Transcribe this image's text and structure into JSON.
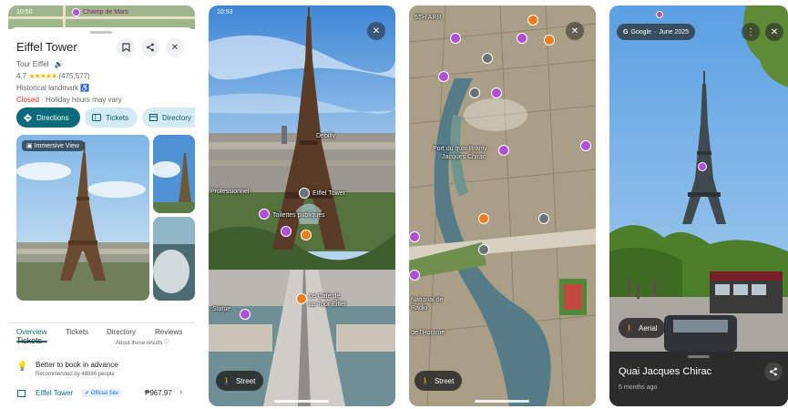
{
  "panel1": {
    "status_time": "10:50",
    "map_label": "Champ de Mars",
    "title": "Eiffel Tower",
    "subtitle": "Tour Eiffel",
    "rating": "4.7",
    "stars": "★★★★★",
    "review_count": "(475,577)",
    "category": "Historical landmark",
    "status_closed": "Closed",
    "status_hours": " · Holiday hours may vary",
    "buttons": {
      "directions": "Directions",
      "tickets": "Tickets",
      "directory": "Directory"
    },
    "photo_chip": "Immersive View",
    "tabs": [
      "Overview",
      "Tickets",
      "Directory",
      "Reviews"
    ],
    "tickets_heading": "Tickets",
    "about_results": "About these results",
    "tip_title": "Better to book in advance",
    "tip_sub": "Recommended by 48886 people",
    "ticket_vendor": "Eiffel Tower",
    "official_badge": "Official Site",
    "ticket_price": "₱967.97"
  },
  "panel2": {
    "status_time": "10:53",
    "labels": {
      "eiffel": "Eiffel Tower",
      "toilets": "Toilettes publiques",
      "pro": "Professionnel",
      "debilly": "Debilly",
      "cafe_line1": "Le Café de",
      "cafe_line2": "La Tour Eiffel",
      "statue": "Statue"
    },
    "chip": "Street"
  },
  "panel3": {
    "corner_label": "5TH ARR",
    "quai_line1": "Port du quai Branly",
    "quai_line2": "Jacques Chirac",
    "left_line1": "National de",
    "left_line2": "Radio",
    "left_line3": "de l'Homme",
    "chip": "Street"
  },
  "panel4": {
    "google_label": "Google",
    "date": "June 2025",
    "chip": "Aerial",
    "place_title": "Quai Jacques Chirac",
    "place_sub": "5 months ago"
  },
  "icons": [
    "bookmark-icon",
    "share-icon",
    "close-icon",
    "directions-icon",
    "ticket-icon",
    "directory-icon",
    "info-icon",
    "bulb-icon",
    "person-icon",
    "more-icon"
  ],
  "colors": {
    "accent": "#0b6b7a",
    "accent_light": "#d3ecf3",
    "closed": "#d93025",
    "pin_purple": "#b14fd6",
    "pin_orange": "#f07d1c"
  }
}
